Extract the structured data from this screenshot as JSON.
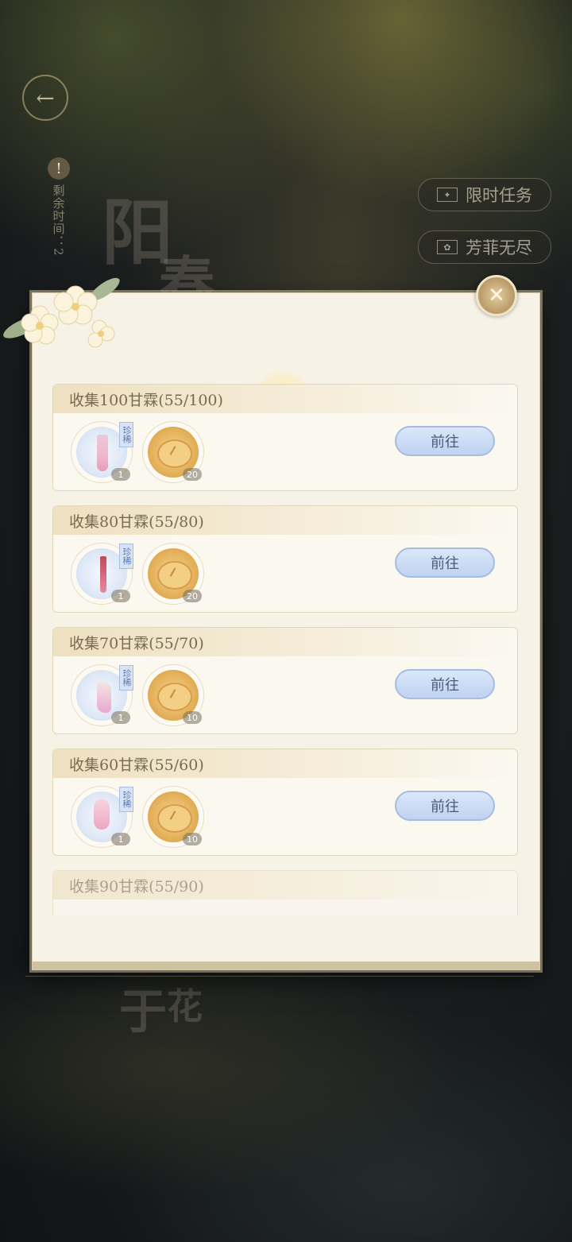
{
  "background": {
    "deco_chars": [
      "阳",
      "春"
    ],
    "deco_chars_bottom": [
      "于",
      "花"
    ]
  },
  "header": {
    "back_icon": "back-arrow-icon",
    "timer_label": "剩余时间：2"
  },
  "side_buttons": [
    {
      "label": "限时任务",
      "icon": "ticket-icon"
    },
    {
      "label": "芳菲无尽",
      "icon": "flower-badge-icon"
    }
  ],
  "modal": {
    "close_icon": "close-icon",
    "tasks": [
      {
        "title": "收集100甘霖(55/100)",
        "rewards": [
          {
            "kind": "cloth",
            "rare": "珍稀",
            "count": "1"
          },
          {
            "kind": "coin",
            "count": "20"
          }
        ],
        "button": "前往"
      },
      {
        "title": "收集80甘霖(55/80)",
        "rewards": [
          {
            "kind": "cloth",
            "rare": "珍稀",
            "count": "1"
          },
          {
            "kind": "coin",
            "count": "20"
          }
        ],
        "button": "前往"
      },
      {
        "title": "收集70甘霖(55/70)",
        "rewards": [
          {
            "kind": "cloth",
            "rare": "珍稀",
            "count": "1"
          },
          {
            "kind": "coin",
            "count": "10"
          }
        ],
        "button": "前往"
      },
      {
        "title": "收集60甘霖(55/60)",
        "rewards": [
          {
            "kind": "cloth",
            "rare": "珍稀",
            "count": "1"
          },
          {
            "kind": "coin",
            "count": "10"
          }
        ],
        "button": "前往"
      },
      {
        "title": "收集90甘霖(55/90)"
      }
    ]
  },
  "colors": {
    "panel_bg": "#f7f2e6",
    "button_bg": "#bfd2f0",
    "title_text": "#7a6a52"
  }
}
